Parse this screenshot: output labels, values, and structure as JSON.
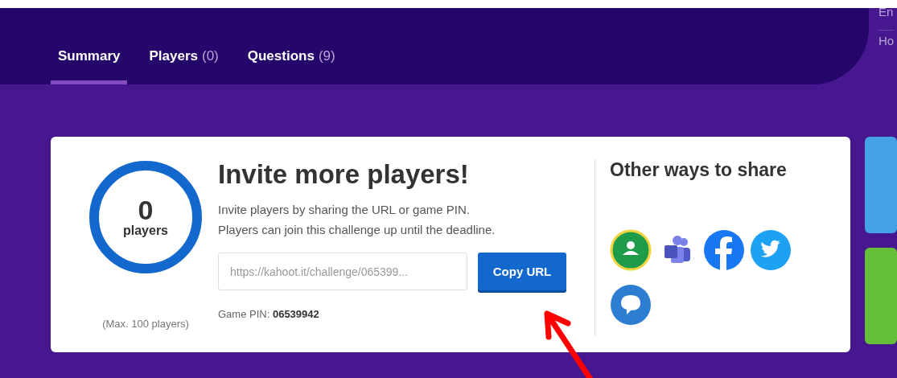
{
  "header": {
    "tabs": [
      {
        "label": "Summary",
        "selected": true
      },
      {
        "label": "Players",
        "count": "(0)",
        "selected": false
      },
      {
        "label": "Questions",
        "count": "(9)",
        "selected": false
      }
    ]
  },
  "sidebar": {
    "items": [
      "En",
      "Ho"
    ]
  },
  "players": {
    "count": "0",
    "unit": "players",
    "limit": "(Max. 100 players)"
  },
  "invite": {
    "title": "Invite more players!",
    "description": [
      "Invite players by sharing the URL or game PIN.",
      "Players can join this challenge up until the deadline."
    ],
    "url": "https://kahoot.it/challenge/065399...",
    "copy_button": "Copy URL",
    "pin": "Game PIN: **06539942**"
  },
  "share": {
    "title": "Other ways to share",
    "services": [
      {
        "kind": "classroom"
      },
      {
        "kind": "teams"
      },
      {
        "kind": "facebook"
      },
      {
        "kind": "twitter"
      },
      {
        "kind": "chat"
      }
    ]
  },
  "side_cards": [
    {
      "color": "#45a3e5"
    },
    {
      "color": "#66bf39"
    }
  ]
}
